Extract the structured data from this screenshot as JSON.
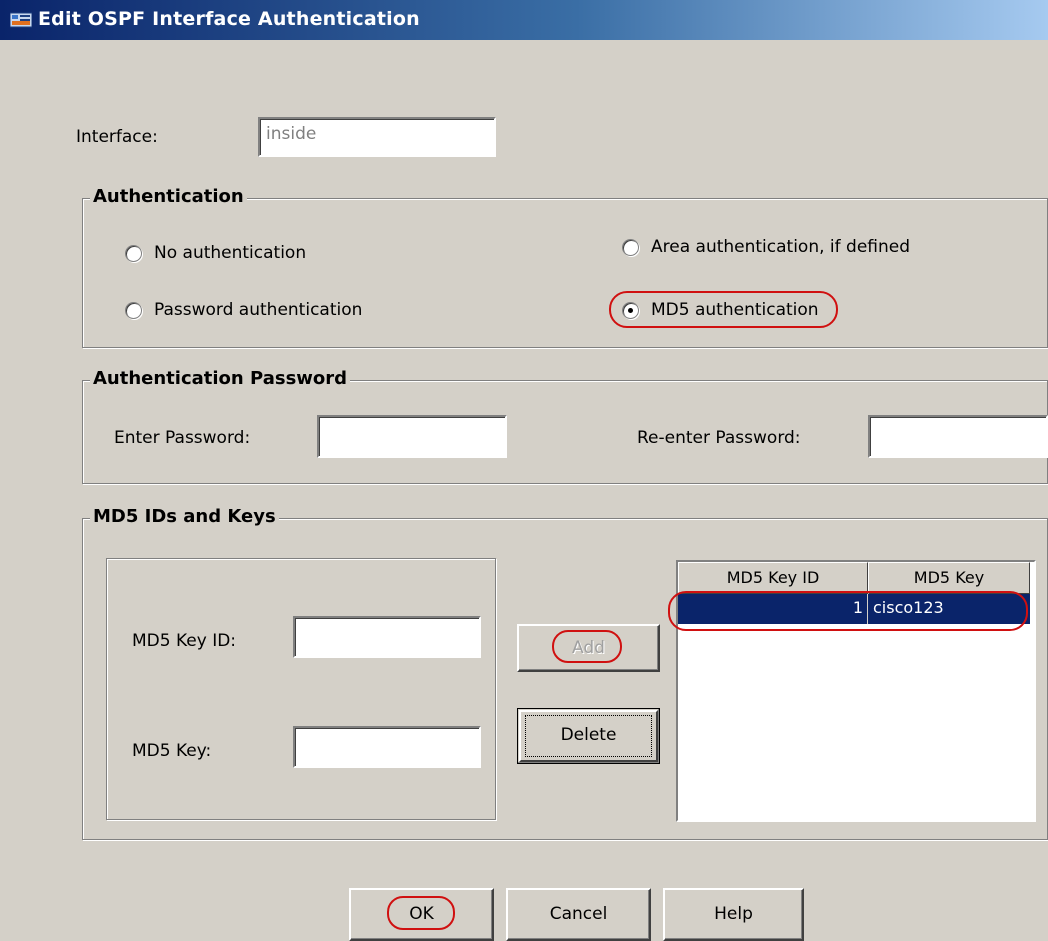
{
  "window": {
    "title": "Edit OSPF Interface Authentication"
  },
  "interface": {
    "label": "Interface:",
    "value": "inside"
  },
  "authentication": {
    "legend": "Authentication",
    "options": [
      {
        "label": "No authentication",
        "selected": false
      },
      {
        "label": "Area authentication, if defined",
        "selected": false
      },
      {
        "label": "Password authentication",
        "selected": false
      },
      {
        "label": "MD5 authentication",
        "selected": true
      }
    ]
  },
  "auth_password": {
    "legend": "Authentication Password",
    "enter_label": "Enter Password:",
    "enter_value": "",
    "reenter_label": "Re-enter Password:",
    "reenter_value": ""
  },
  "md5": {
    "legend": "MD5 IDs and Keys",
    "key_id_label": "MD5 Key ID:",
    "key_id_value": "",
    "key_label": "MD5 Key:",
    "key_value": "",
    "add_label": "Add",
    "delete_label": "Delete",
    "table": {
      "columns": [
        "MD5 Key ID",
        "MD5 Key"
      ],
      "rows": [
        {
          "key_id": "1",
          "key": "cisco123",
          "selected": true
        }
      ]
    }
  },
  "buttons": {
    "ok": "OK",
    "cancel": "Cancel",
    "help": "Help"
  },
  "colors": {
    "selection": "#0a246a",
    "highlight_ring": "#d01010",
    "dialog_bg": "#d4d0c8"
  }
}
